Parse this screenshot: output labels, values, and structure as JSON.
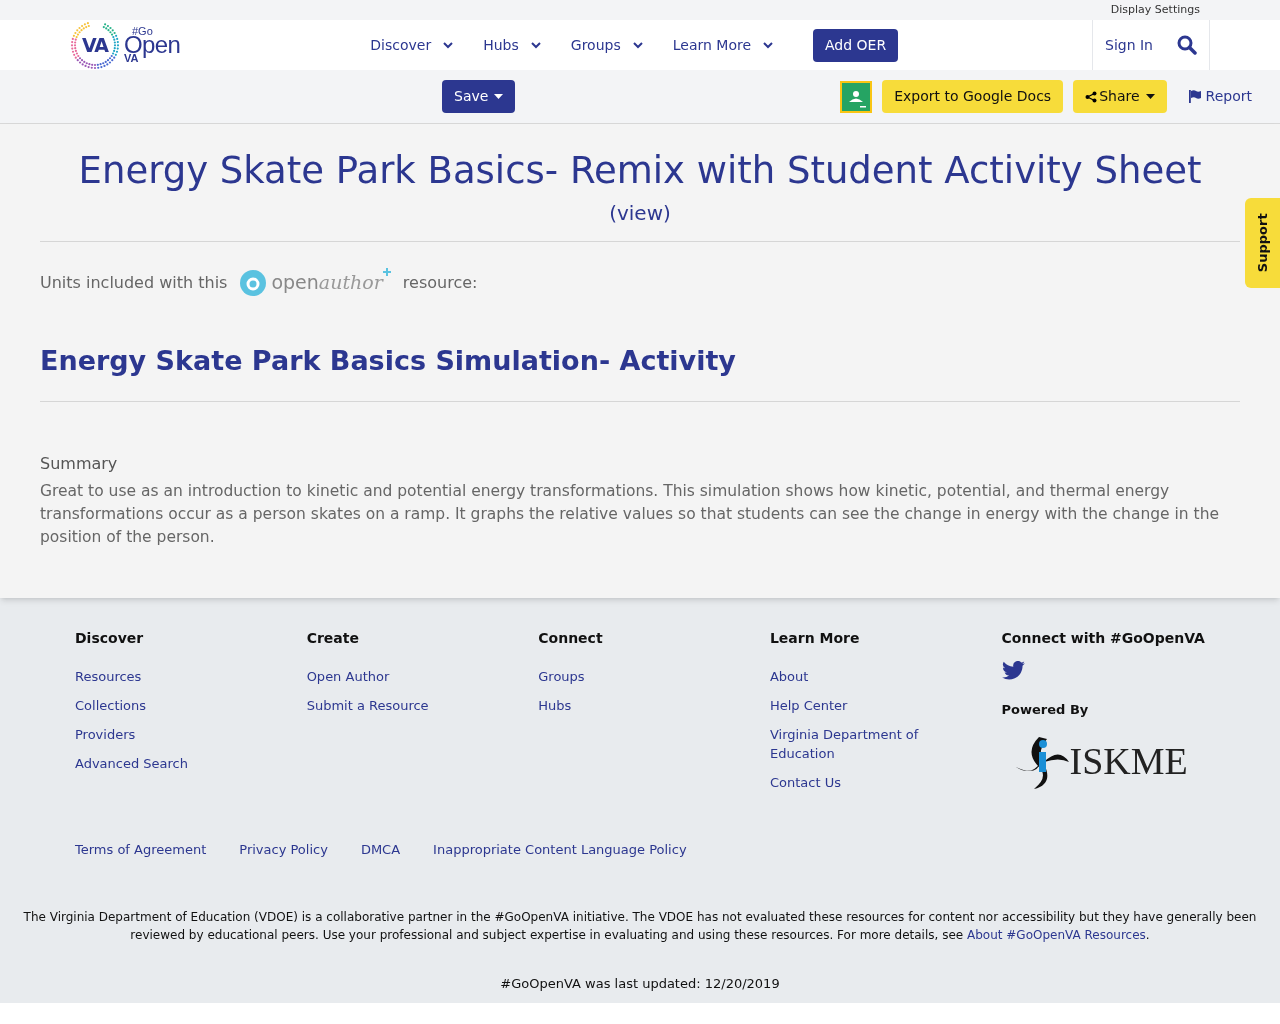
{
  "top_bar": {
    "link": "Display Settings"
  },
  "header": {
    "logo": {
      "badge": "VA",
      "hashtag": "#Go",
      "word": "Open",
      "state": "VA"
    },
    "nav": [
      {
        "label": "Discover"
      },
      {
        "label": "Hubs"
      },
      {
        "label": "Groups"
      },
      {
        "label": "Learn More"
      }
    ],
    "add_button": "Add OER",
    "sign_in": "Sign In"
  },
  "toolbar": {
    "save": "Save",
    "export": "Export to Google Docs",
    "share": "Share",
    "report": "Report"
  },
  "support_tab": "Support",
  "resource": {
    "title": "Energy Skate Park Basics- Remix with Student Activity Sheet",
    "view_link": "(view)",
    "units_prefix": "Units included with this",
    "units_logo": {
      "first": "open",
      "second": "author"
    },
    "units_suffix": "resource:",
    "unit_title": "Energy Skate Park Basics Simulation- Activity",
    "summary_heading": "Summary",
    "summary": "Great to use as an introduction to kinetic and potential energy transformations. This simulation shows how kinetic, potential, and thermal energy transformations occur as a person skates on a ramp. It graphs the relative values so that students can see the change in energy with the change in the position of the person."
  },
  "footer": {
    "columns": [
      {
        "heading": "Discover",
        "links": [
          "Resources",
          "Collections",
          "Providers",
          "Advanced Search"
        ]
      },
      {
        "heading": "Create",
        "links": [
          "Open Author",
          "Submit a Resource"
        ]
      },
      {
        "heading": "Connect",
        "links": [
          "Groups",
          "Hubs"
        ]
      },
      {
        "heading": "Learn More",
        "links": [
          "About",
          "Help Center",
          "Virginia Department of Education",
          "Contact Us"
        ]
      }
    ],
    "connect_heading": "Connect with #GoOpenVA",
    "powered_by": "Powered By",
    "powered_logo": "ISKME",
    "legal_links": [
      "Terms of Agreement",
      "Privacy Policy",
      "DMCA",
      "Inappropriate Content Language Policy"
    ],
    "disclaimer": "The Virginia Department of Education (VDOE) is a collaborative partner in the #GoOpenVA initiative. The VDOE has not evaluated these resources for content nor accessibility but they have generally been reviewed by educational peers. Use your professional and subject expertise in evaluating and using these resources. For more details, see",
    "disclaimer_link": "About #GoOpenVA Resources",
    "disclaimer_end": ".",
    "updated": "#GoOpenVA was last updated: 12/20/2019"
  }
}
